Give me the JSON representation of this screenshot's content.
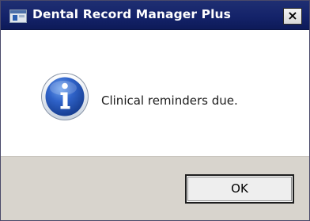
{
  "window": {
    "title": "Dental Record Manager Plus",
    "close_label": "×"
  },
  "message": {
    "text": "Clinical reminders due.",
    "icon": "info-icon"
  },
  "buttons": {
    "ok_label": "OK"
  }
}
